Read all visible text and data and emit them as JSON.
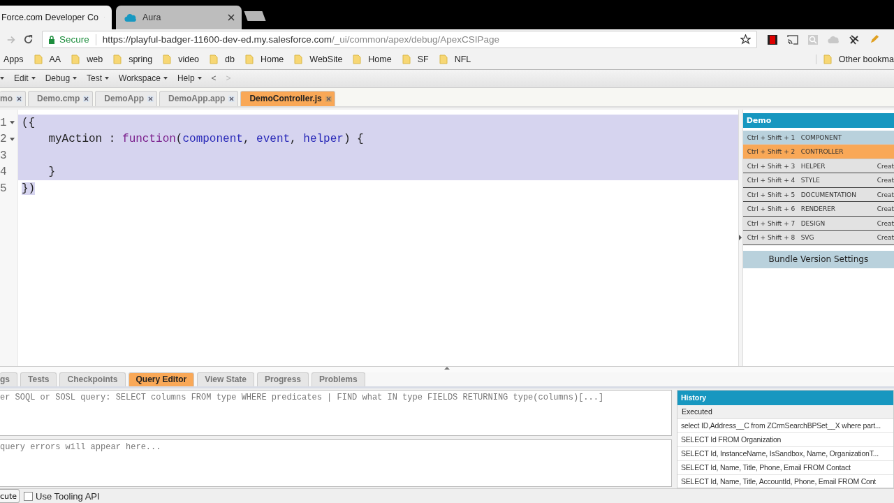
{
  "browser_tabs": [
    {
      "title": "Force.com Developer Co",
      "selected": true
    },
    {
      "title": "Aura",
      "selected": false
    }
  ],
  "address_bar": {
    "secure_label": "Secure",
    "url_host": "https://playful-badger-11600-dev-ed.my.salesforce.com",
    "url_path": "/_ui/common/apex/debug/ApexCSIPage"
  },
  "bookmarks": [
    {
      "label": "Apps",
      "kind": "apps"
    },
    {
      "label": "AA",
      "kind": "folder"
    },
    {
      "label": "web",
      "kind": "folder"
    },
    {
      "label": "spring",
      "kind": "folder"
    },
    {
      "label": "video",
      "kind": "folder"
    },
    {
      "label": "db",
      "kind": "folder"
    },
    {
      "label": "Home",
      "kind": "folder"
    },
    {
      "label": "WebSite",
      "kind": "folder"
    },
    {
      "label": "Home",
      "kind": "folder"
    },
    {
      "label": "SF",
      "kind": "folder"
    },
    {
      "label": "NFL",
      "kind": "folder"
    }
  ],
  "other_bookmarks": "Other bookma",
  "menu": [
    "Edit",
    "Debug",
    "Test",
    "Workspace",
    "Help"
  ],
  "nav": {
    "back": "<",
    "forward": ">"
  },
  "file_tabs": [
    {
      "label": "mo",
      "selected": false
    },
    {
      "label": "Demo.cmp",
      "selected": false
    },
    {
      "label": "DemoApp",
      "selected": false
    },
    {
      "label": "DemoApp.app",
      "selected": false
    },
    {
      "label": "DemoController.js",
      "selected": true
    }
  ],
  "editor_lines": [
    {
      "number": "1",
      "foldable": true,
      "selected": true,
      "tokens": [
        {
          "text": "({",
          "kind": "plain"
        }
      ]
    },
    {
      "number": "2",
      "foldable": true,
      "selected": true,
      "tokens": [
        {
          "text": "    myAction : ",
          "kind": "plain"
        },
        {
          "text": "function",
          "kind": "keyword"
        },
        {
          "text": "(",
          "kind": "plain"
        },
        {
          "text": "component",
          "kind": "param"
        },
        {
          "text": ", ",
          "kind": "plain"
        },
        {
          "text": "event",
          "kind": "param"
        },
        {
          "text": ", ",
          "kind": "plain"
        },
        {
          "text": "helper",
          "kind": "param"
        },
        {
          "text": ") {",
          "kind": "plain"
        }
      ]
    },
    {
      "number": "3",
      "foldable": false,
      "selected": true
    },
    {
      "number": "4",
      "foldable": false,
      "selected": true,
      "tokens": [
        {
          "text": "    }",
          "kind": "plain"
        }
      ]
    },
    {
      "number": "5",
      "foldable": false,
      "selected": true,
      "tokens": [
        {
          "text": "})",
          "kind": "plain"
        }
      ]
    }
  ],
  "bundle": {
    "title": "Demo",
    "rows": [
      {
        "shortcut": "Ctrl + Shift + 1",
        "name": "COMPONENT",
        "exists": true,
        "selected": false
      },
      {
        "shortcut": "Ctrl + Shift + 2",
        "name": "CONTROLLER",
        "exists": true,
        "selected": true
      },
      {
        "shortcut": "Ctrl + Shift + 3",
        "name": "HELPER",
        "exists": false,
        "selected": false,
        "action": "Creat"
      },
      {
        "shortcut": "Ctrl + Shift + 4",
        "name": "STYLE",
        "exists": false,
        "selected": false,
        "action": "Creat"
      },
      {
        "shortcut": "Ctrl + Shift + 5",
        "name": "DOCUMENTATION",
        "exists": false,
        "selected": false,
        "action": "Creat"
      },
      {
        "shortcut": "Ctrl + Shift + 6",
        "name": "RENDERER",
        "exists": false,
        "selected": false,
        "action": "Creat"
      },
      {
        "shortcut": "Ctrl + Shift + 7",
        "name": "DESIGN",
        "exists": false,
        "selected": false,
        "action": "Creat"
      },
      {
        "shortcut": "Ctrl + Shift + 8",
        "name": "SVG",
        "exists": false,
        "selected": false,
        "action": "Creat"
      }
    ],
    "settings_button": "Bundle Version Settings"
  },
  "panel_tabs": [
    {
      "label": "gs",
      "selected": false
    },
    {
      "label": "Tests",
      "selected": false
    },
    {
      "label": "Checkpoints",
      "selected": false
    },
    {
      "label": "Query Editor",
      "selected": true
    },
    {
      "label": "View State",
      "selected": false
    },
    {
      "label": "Progress",
      "selected": false
    },
    {
      "label": "Problems",
      "selected": false
    }
  ],
  "query": {
    "placeholder": "er SOQL or SOSL query: SELECT columns FROM type WHERE predicates | FIND what IN type FIELDS RETURNING type(columns)[...]"
  },
  "errors": {
    "placeholder": " query errors will appear here..."
  },
  "history": {
    "title": "History",
    "column": "Executed",
    "rows": [
      "select ID,Address__C from ZCrmSearchBPSet__X where part...",
      "SELECT Id FROM Organization",
      "SELECT Id, InstanceName, IsSandbox, Name, OrganizationT...",
      "SELECT Id, Name, Title, Phone, Email FROM Contact",
      "SELECT Id, Name, Title, AccountId, Phone, Email FROM Cont"
    ]
  },
  "execute_button": "cute",
  "tooling_api": {
    "label": "Use Tooling API",
    "checked": false
  }
}
